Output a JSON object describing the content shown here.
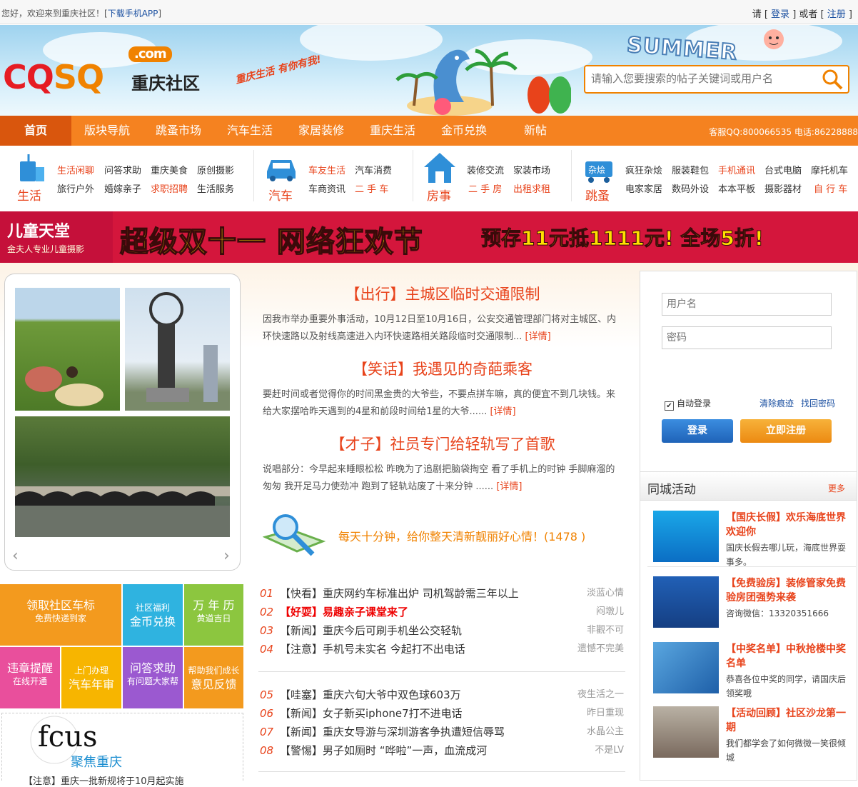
{
  "topbar": {
    "welcome": "您好，欢迎来到重庆社区！[",
    "app_link": "下载手机APP",
    "close": "]",
    "please": "请",
    "login": "登录",
    "or": "或者",
    "register": "注册"
  },
  "header": {
    "logo_en1": "CQ",
    "logo_en2": "SQ",
    "logo_com": ".com",
    "logo_cn": "重庆社区",
    "slogan": "重庆生活 有你有我!",
    "summer": "SUMMER",
    "search_placeholder": "请输入您要搜索的帖子关键词或用户名"
  },
  "nav": {
    "items": [
      "首页",
      "版块导航",
      "跳蚤市场",
      "汽车生活",
      "家居装修",
      "重庆生活",
      "金币兑换",
      "新帖"
    ],
    "hotline": "客服QQ:800066535 电话:86228888"
  },
  "cats": [
    {
      "label": "生活",
      "links": [
        [
          "生活闲聊",
          "o"
        ],
        [
          "问答求助",
          ""
        ],
        [
          "重庆美食",
          ""
        ],
        [
          "原创摄影",
          ""
        ],
        [
          "旅行户外",
          ""
        ],
        [
          "婚嫁亲子",
          ""
        ],
        [
          "求职招聘",
          "o"
        ],
        [
          "生活服务",
          ""
        ]
      ]
    },
    {
      "label": "汽车",
      "links": [
        [
          "车友生活",
          "o"
        ],
        [
          "汽车消费",
          ""
        ],
        [
          "车商资讯",
          ""
        ],
        [
          "二 手 车",
          "o"
        ]
      ]
    },
    {
      "label": "房事",
      "links": [
        [
          "装修交流",
          ""
        ],
        [
          "家装市场",
          ""
        ],
        [
          "二 手 房",
          "o"
        ],
        [
          "出租求租",
          "o"
        ]
      ]
    },
    {
      "label": "跳蚤",
      "links": [
        [
          "疯狂杂烩",
          ""
        ],
        [
          "服装鞋包",
          ""
        ],
        [
          "手机通讯",
          "o"
        ],
        [
          "台式电脑",
          ""
        ],
        [
          "摩托机车",
          ""
        ],
        [
          "电家家居",
          ""
        ],
        [
          "数码外设",
          ""
        ],
        [
          "本本平板",
          ""
        ],
        [
          "摄影器材",
          ""
        ],
        [
          "自 行 车",
          "o"
        ]
      ]
    }
  ],
  "banner": {
    "brand": "儿童天堂",
    "brand_sub": "金夫人专业儿童摄影",
    "headline": "超级双十一 网络狂欢节",
    "promo": "预存11元抵1111元! 全场5折!"
  },
  "news": [
    {
      "title": "【出行】主城区临时交通限制",
      "body": "因我市举办重要外事活动，10月12日至10月16日，公安交通管理部门将对主城区、内环快速路以及射线高速进入内环快速路相关路段临时交通限制... ",
      "more": "[详情]"
    },
    {
      "title": "【笑话】我遇见的奇葩乘客",
      "body": "要赶时间或者觉得你的时间黑金贵的大爷些，不要点拼车嘛，真的便宜不到几块钱。来给大家摆哈昨天遇到的4星和前段时间给1星的大爷...... ",
      "more": "[详情]"
    },
    {
      "title": "【才子】社员专门给轻轨写了首歌",
      "body": "说唱部分：今早起来睡眼松松 昨晚为了追剧把脑袋掏空 看了手机上的时钟 手脚麻溜的匆匆 我开足马力使劲冲 跑到了轻轨站废了十来分钟 ...... ",
      "more": "[详情]"
    }
  ],
  "daily": "每天十分钟，给你整天清新靓丽好心情！(1478 )",
  "list1": [
    {
      "n": "01",
      "t": "【快看】重庆网约车标准出炉 司机驾龄需三年以上",
      "a": "淡蓝心情"
    },
    {
      "n": "02",
      "t": "【好耍】易趣亲子课堂来了",
      "a": "闷墩儿",
      "hl": true
    },
    {
      "n": "03",
      "t": "【新闻】重庆今后可刷手机坐公交轻轨",
      "a": "非觀不可"
    },
    {
      "n": "04",
      "t": "【注意】手机号未实名 今起打不出电话",
      "a": "遗憾不完美"
    }
  ],
  "list2": [
    {
      "n": "05",
      "t": "【哇塞】重庆六旬大爷中双色球603万",
      "a": "夜生活之一"
    },
    {
      "n": "06",
      "t": "【新闻】女子新买iphone7打不进电话",
      "a": "昨日重现"
    },
    {
      "n": "07",
      "t": "【新闻】重庆女导游与深圳游客争执遭短信辱骂",
      "a": "水晶公主"
    },
    {
      "n": "08",
      "t": "【警惕】男子如厕时 “哗啦”一声，血流成河",
      "a": "不是LV"
    }
  ],
  "tiles": [
    {
      "t": "领取社区车标",
      "s": "免费快递到家",
      "c": "#f39a1e"
    },
    {
      "t": "社区福利",
      "s2": "金币兑换",
      "c": "#2fb3e0"
    },
    {
      "t": "万 年 历",
      "s": "黄道吉日",
      "c": "#8cc63f"
    },
    {
      "t": "违章提醒",
      "s": "在线开通",
      "c": "#e94f9c"
    },
    {
      "t": "上门办理",
      "s2": "汽车年审",
      "c": "#f7b500"
    },
    {
      "t": "问答求助",
      "s": "有问题大家帮",
      "c": "#9b59d0"
    },
    {
      "t": "帮助我们成长",
      "s2": "意见反馈",
      "c": "#f39a1e"
    }
  ],
  "focus": {
    "logo": "fcus",
    "cn": "聚焦重庆",
    "item": "【注意】重庆一批新规将于10月起实施"
  },
  "login": {
    "user_ph": "用户名",
    "pass_ph": "密码",
    "auto": "自动登录",
    "clear": "清除痕迹",
    "find": "找回密码",
    "login_btn": "登录",
    "reg_btn": "立即注册"
  },
  "activity": {
    "title": "同城活动",
    "more": "更多",
    "items": [
      {
        "t": "【国庆长假】欢乐海底世界欢迎你",
        "d": "国庆长假去哪儿玩，海底世界耍事多。"
      },
      {
        "t": "【免费验房】装修管家免费验房团强势来袭",
        "d": "咨询微信：13320351666"
      },
      {
        "t": "【中奖名单】中秋抢楼中奖名单",
        "d": "恭喜各位中奖的同学，请国庆后领奖哦"
      },
      {
        "t": "【活动回顾】社区沙龙第一期",
        "d": "我们都学会了如何微微一笑很倾城"
      }
    ]
  },
  "colors": {
    "orange": "#f58220",
    "red": "#e8431b",
    "blue": "#1a4fa0"
  }
}
